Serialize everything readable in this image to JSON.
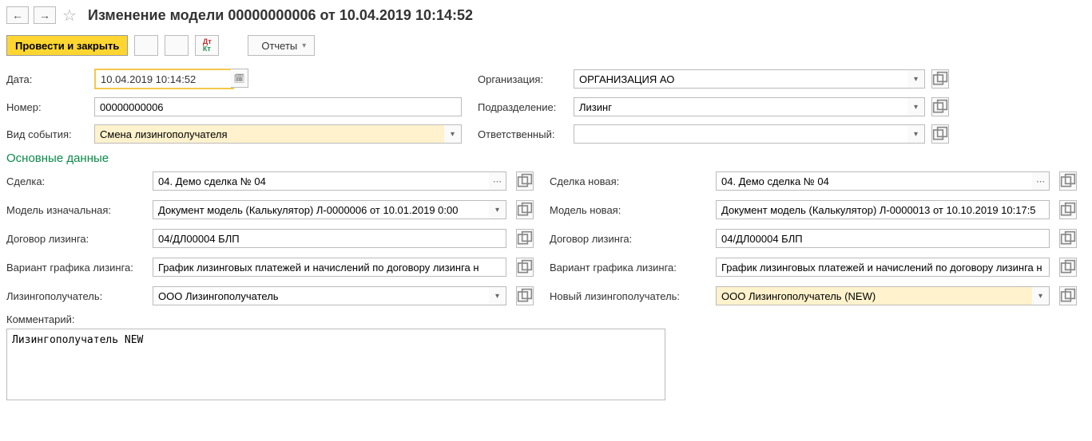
{
  "header": {
    "title": "Изменение модели 00000000006 от 10.04.2019 10:14:52"
  },
  "toolbar": {
    "primary_label": "Провести и закрыть",
    "reports_label": "Отчеты"
  },
  "top_form": {
    "date_label": "Дата:",
    "date_value": "10.04.2019 10:14:52",
    "number_label": "Номер:",
    "number_value": "00000000006",
    "event_type_label": "Вид события:",
    "event_type_value": "Смена лизингополучателя",
    "org_label": "Организация:",
    "org_value": "ОРГАНИЗАЦИЯ АО",
    "dept_label": "Подразделение:",
    "dept_value": "Лизинг",
    "resp_label": "Ответственный:",
    "resp_value": ""
  },
  "section_title": "Основные данные",
  "left": {
    "deal_label": "Сделка:",
    "deal_value": "04. Демо сделка № 04",
    "model_orig_label": "Модель изначальная:",
    "model_orig_value": "Документ модель (Калькулятор) Л-0000006 от 10.01.2019 0:00",
    "lease_contract_label": "Договор лизинга:",
    "lease_contract_value": "04/ДЛ00004 БЛП",
    "schedule_label": "Вариант графика лизинга:",
    "schedule_value": "График лизинговых платежей и начислений по договору лизинга н",
    "lessee_label": "Лизингополучатель:",
    "lessee_value": "ООО Лизингополучатель"
  },
  "right": {
    "deal_new_label": "Сделка новая:",
    "deal_new_value": "04. Демо сделка № 04",
    "model_new_label": "Модель новая:",
    "model_new_value": "Документ модель (Калькулятор) Л-0000013 от 10.10.2019 10:17:5",
    "lease_contract_label": "Договор лизинга:",
    "lease_contract_value": "04/ДЛ00004 БЛП",
    "schedule_label": "Вариант графика лизинга:",
    "schedule_value": "График лизинговых платежей и начислений по договору лизинга н",
    "new_lessee_label": "Новый лизингополучатель:",
    "new_lessee_value": "ООО Лизингополучатель (NEW)"
  },
  "comment": {
    "label": "Комментарий:",
    "value": "Лизингополучатель NEW"
  }
}
